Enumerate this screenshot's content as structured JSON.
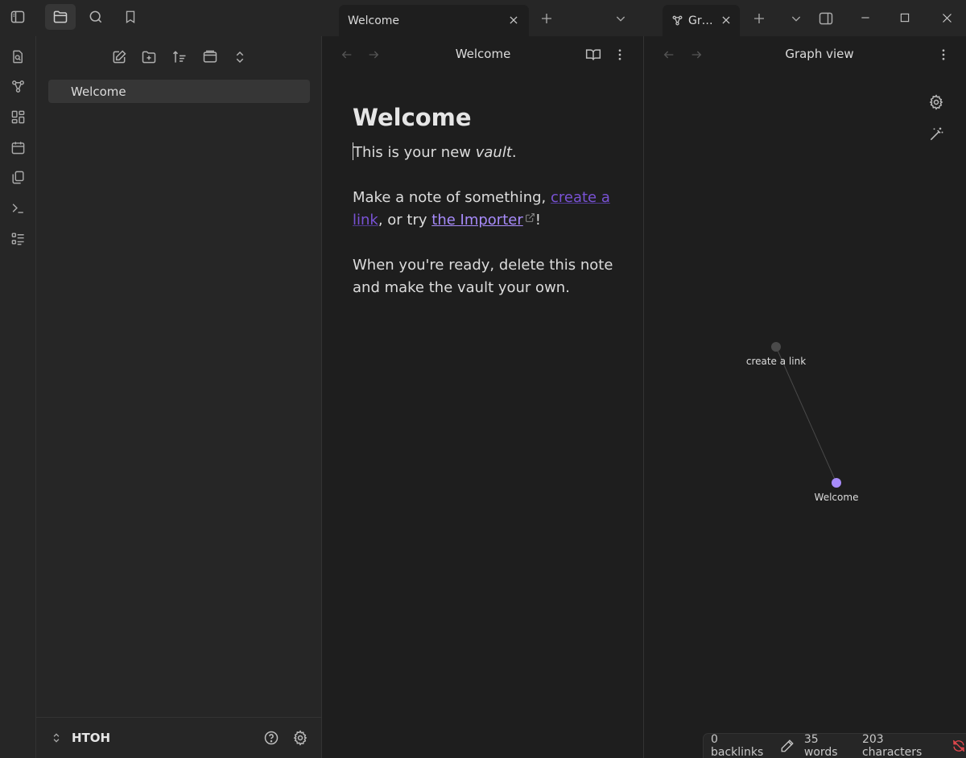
{
  "tabs": {
    "editor_title": "Welcome",
    "graph_title": "Gr…"
  },
  "sidebar": {
    "files": [
      {
        "label": "Welcome"
      }
    ],
    "vault_name": "НТОН"
  },
  "editor": {
    "header_title": "Welcome",
    "note": {
      "heading": "Welcome",
      "p1_before": "This is your new ",
      "p1_em": "vault",
      "p1_after": ".",
      "p2_before": "Make a note of something, ",
      "p2_link1": "create a link",
      "p2_mid": ", or try ",
      "p2_link2": "the Importer",
      "p2_after": "!",
      "p3": "When you're ready, delete this note and make the vault your own."
    }
  },
  "graph": {
    "header_title": "Graph view",
    "nodes": [
      {
        "label": "create a link",
        "color": "#4a4a4a"
      },
      {
        "label": "Welcome",
        "color": "#a78bfa"
      }
    ]
  },
  "status": {
    "backlinks": "0 backlinks",
    "words": "35 words",
    "characters": "203 characters",
    "sync_color": "#e5484d"
  },
  "colors": {
    "accent": "#a78bfa",
    "background": "#1e1e1e",
    "panel": "#262626"
  }
}
